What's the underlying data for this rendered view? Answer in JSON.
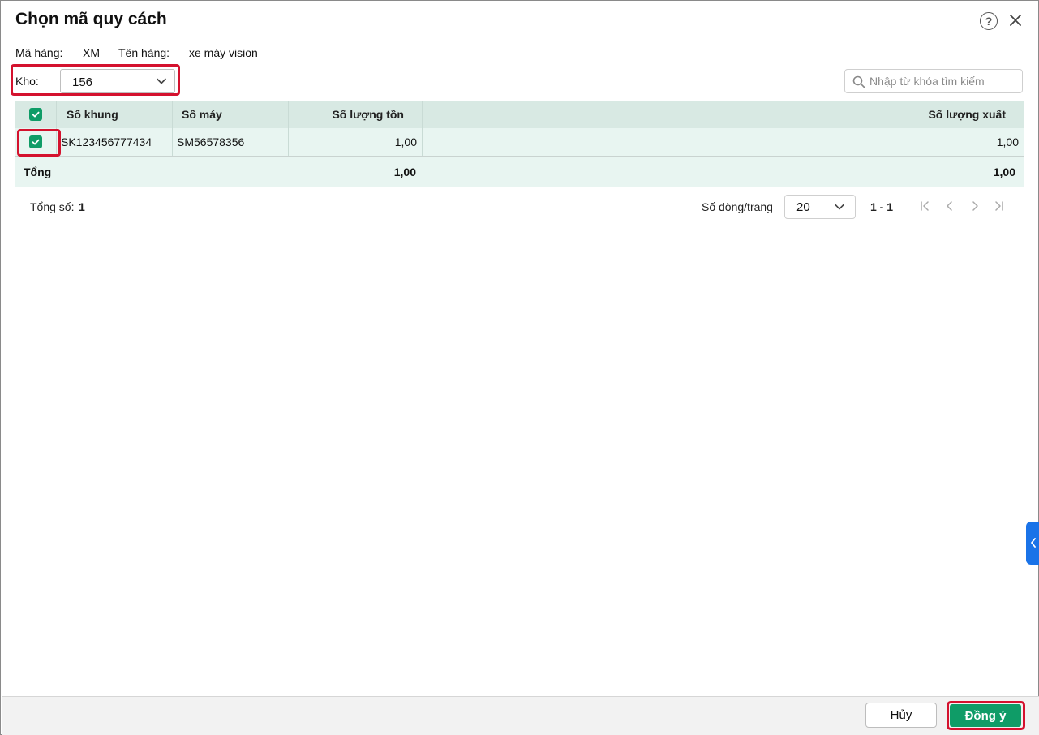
{
  "dialog": {
    "title": "Chọn mã quy cách",
    "help_icon": "help-circle-icon",
    "close_icon": "close-icon"
  },
  "info": {
    "ma_hang_label": "Mã hàng:",
    "ma_hang_value": "XM",
    "ten_hang_label": "Tên hàng:",
    "ten_hang_value": "xe máy vision"
  },
  "kho": {
    "label": "Kho:",
    "value": "156"
  },
  "search": {
    "placeholder": "Nhập từ khóa tìm kiếm"
  },
  "table": {
    "headers": {
      "so_khung": "Số khung",
      "so_may": "Số máy",
      "so_luong_ton": "Số lượng tồn",
      "so_luong_xuat": "Số lượng xuất"
    },
    "rows": [
      {
        "checked": true,
        "so_khung": "SK123456777434",
        "so_may": "SM56578356",
        "so_luong_ton": "1,00",
        "so_luong_xuat": "1,00"
      }
    ],
    "total": {
      "label": "Tổng",
      "so_luong_ton": "1,00",
      "so_luong_xuat": "1,00"
    }
  },
  "pagination": {
    "total_label": "Tổng số:",
    "total_value": "1",
    "rows_per_page_label": "Số dòng/trang",
    "rows_per_page_value": "20",
    "range": "1 - 1"
  },
  "footer": {
    "cancel_label": "Hủy",
    "ok_label": "Đồng ý"
  },
  "colors": {
    "accent_green": "#0f9c67",
    "highlight_red": "#d4122e",
    "header_bg": "#d8e9e3",
    "row_bg": "#e8f5f1",
    "side_tab_blue": "#1a73e8"
  }
}
